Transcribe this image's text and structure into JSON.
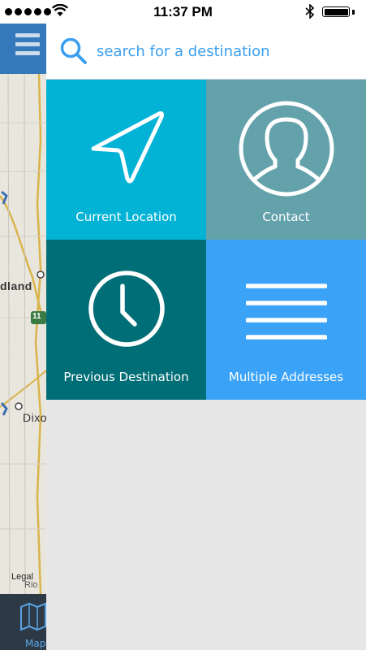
{
  "status_bar": {
    "time": "11:37 PM",
    "bluetooth_icon": "bluetooth-icon",
    "battery_level": 1.0
  },
  "map": {
    "city_1": "dland",
    "city_2": "Dixo",
    "city_3": "Rio",
    "highway_shield": "11",
    "legal": "Legal",
    "tab_label": "Map"
  },
  "search": {
    "placeholder": "search for a destination",
    "icon": "search-icon"
  },
  "tiles": [
    {
      "label": "Current Location",
      "icon": "location-arrow-icon",
      "color": "#02b3d6"
    },
    {
      "label": "Contact",
      "icon": "person-icon",
      "color": "#64a2ab"
    },
    {
      "label": "Previous Destination",
      "icon": "clock-icon",
      "color": "#006e76"
    },
    {
      "label": "Multiple Addresses",
      "icon": "list-icon",
      "color": "#3ba3f7"
    }
  ]
}
